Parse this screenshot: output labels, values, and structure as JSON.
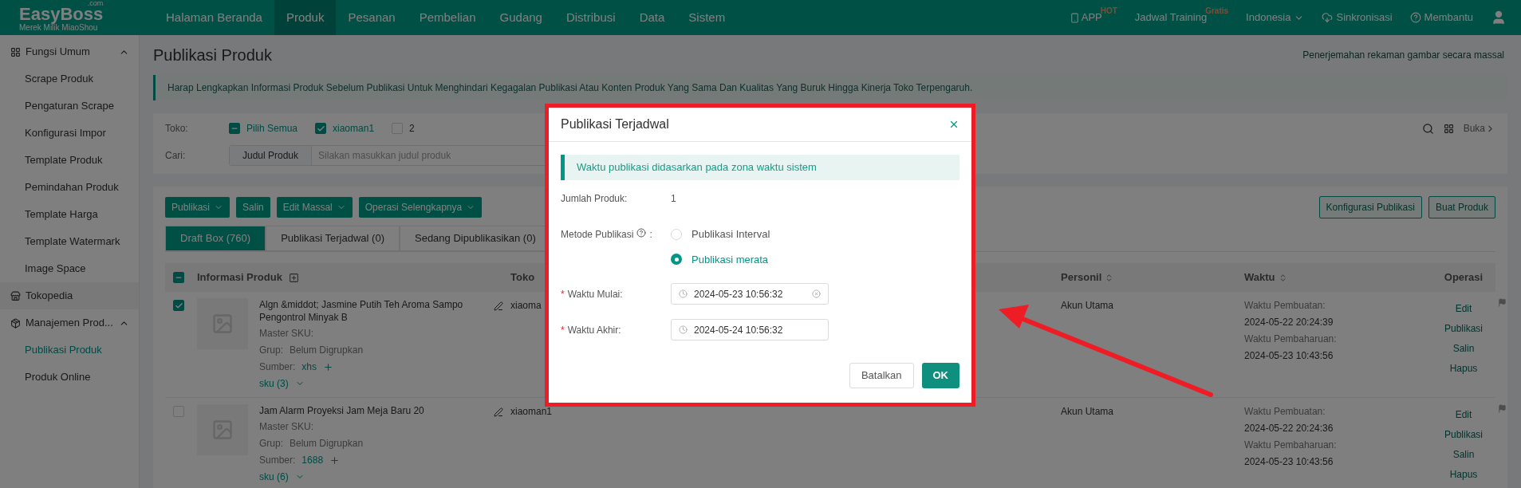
{
  "logo": {
    "name": "EasyBoss",
    "sup": ".com",
    "sub": "Merek Milik MiaoShou"
  },
  "nav": [
    {
      "label": "Halaman Beranda",
      "selected": false
    },
    {
      "label": "Produk",
      "selected": true
    },
    {
      "label": "Pesanan",
      "selected": false
    },
    {
      "label": "Pembelian",
      "selected": false
    },
    {
      "label": "Gudang",
      "selected": false
    },
    {
      "label": "Distribusi",
      "selected": false
    },
    {
      "label": "Data",
      "selected": false
    },
    {
      "label": "Sistem",
      "selected": false
    }
  ],
  "top_right": [
    {
      "kind": "app",
      "label": "APP",
      "badge": "HOT"
    },
    {
      "kind": "plain",
      "label": "Jadwal Training",
      "badge": "Gratis"
    },
    {
      "kind": "dropdown",
      "label": "Indonesia"
    },
    {
      "kind": "cloud",
      "label": "Sinkronisasi"
    },
    {
      "kind": "help",
      "label": "Membantu"
    },
    {
      "kind": "user"
    }
  ],
  "sidebar": [
    {
      "kind": "grid",
      "label": "Fungsi Umum",
      "expanded": true,
      "children": [
        {
          "label": "Scrape Produk",
          "selected": false
        },
        {
          "label": "Pengaturan Scrape",
          "selected": false
        },
        {
          "label": "Konfigurasi Impor",
          "selected": false
        },
        {
          "label": "Template Produk",
          "selected": false
        },
        {
          "label": "Pemindahan Produk",
          "selected": false
        },
        {
          "label": "Template Harga",
          "selected": false
        },
        {
          "label": "Template Watermark",
          "selected": false
        },
        {
          "label": "Image Space",
          "selected": false
        }
      ]
    },
    {
      "kind": "shop",
      "label": "Tokopedia"
    },
    {
      "kind": "box",
      "label": "Manajemen Prod...",
      "expanded": true,
      "children": [
        {
          "label": "Publikasi Produk",
          "selected": true
        },
        {
          "label": "Produk Online",
          "selected": false
        }
      ]
    }
  ],
  "page_title": "Publikasi Produk",
  "top_link": "Penerjemahan rekaman gambar secara massal",
  "notice": "Harap Lengkapkan Informasi Produk Sebelum Publikasi Untuk Menghindari Kegagalan Publikasi Atau Konten Produk Yang Sama Dan Kualitas Yang Buruk Hingga Kinerja Toko Terpengaruh.",
  "filters": {
    "store_label": "Toko:",
    "stores": [
      {
        "label": "Pilih Semua",
        "checked": true,
        "partial": true
      },
      {
        "label": "xiaoman1",
        "checked": true
      },
      {
        "label": "2",
        "checked": false
      }
    ],
    "search_label": "Cari:",
    "search_type": "Judul Produk",
    "placeholder": "Silakan masukkan judul produk",
    "expand": "Buka"
  },
  "actions": [
    {
      "label": "Publikasi",
      "dropdown": true
    },
    {
      "label": "Salin",
      "dropdown": false
    },
    {
      "label": "Edit Massal",
      "dropdown": true
    },
    {
      "label": "Operasi Selengkapnya",
      "dropdown": true
    }
  ],
  "right_actions": [
    "Konfigurasi Publikasi",
    "Buat Produk"
  ],
  "tabs": [
    {
      "label": "Draft Box (760)",
      "selected": true
    },
    {
      "label": "Publikasi Terjadwal (0)",
      "selected": false
    },
    {
      "label": "Sedang Dipublikasikan (0)",
      "selected": false
    }
  ],
  "table": {
    "header_checked": true,
    "header_partial": true,
    "columns": {
      "info": "Informasi Produk",
      "store": "Toko",
      "person": "Personil",
      "time": "Waktu",
      "ops": "Operasi"
    },
    "rows": [
      {
        "checked": true,
        "title": "Algn &middot; Jasmine Putih Teh Aroma Sampo Pengontrol Minyak B",
        "sku_label": "Master SKU:",
        "group_label": "Grup:",
        "group": "Belum Digrupkan",
        "source_label": "Sumber:",
        "source": "xhs",
        "sku": "sku (3)",
        "store": "xiaoma",
        "person": "Akun Utama",
        "created_label": "Waktu Pembuatan:",
        "created": "2024-05-22 20:24:39",
        "updated_label": "Waktu Pembaharuan:",
        "updated": "2024-05-23 10:43:56",
        "ops": [
          "Edit",
          "Publikasi",
          "Salin",
          "Hapus"
        ]
      },
      {
        "checked": false,
        "title": "Jam Alarm Proyeksi Jam Meja Baru 20",
        "sku_label": "Master SKU:",
        "group_label": "Grup:",
        "group": "Belum Digrupkan",
        "source_label": "Sumber:",
        "source": "1688",
        "sku": "sku (6)",
        "store": "xiaoman1",
        "person": "Akun Utama",
        "created_label": "Waktu Pembuatan:",
        "created": "2024-05-22 20:24:36",
        "updated_label": "Waktu Pembaharuan:",
        "updated": "2024-05-23 10:43:56",
        "ops": [
          "Edit",
          "Publikasi",
          "Salin",
          "Hapus"
        ]
      }
    ]
  },
  "modal": {
    "title": "Publikasi Terjadwal",
    "notice": "Waktu publikasi didasarkan pada zona waktu sistem",
    "count_label": "Jumlah Produk:",
    "count": "1",
    "method_label": "Metode Publikasi",
    "method_colon": ":",
    "methods": [
      {
        "label": "Publikasi Interval",
        "selected": false
      },
      {
        "label": "Publikasi merata",
        "selected": true
      }
    ],
    "fields": [
      {
        "label": "Waktu Mulai:",
        "marker": "*",
        "value": "2024-05-23 10:56:32",
        "clearable": true
      },
      {
        "label": "Waktu Akhir:",
        "marker": "*",
        "value": "2024-05-24 10:56:32",
        "clearable": false
      }
    ],
    "buttons": [
      {
        "label": "Batalkan",
        "kind": "secondary"
      },
      {
        "label": "OK",
        "kind": "primary"
      }
    ]
  }
}
